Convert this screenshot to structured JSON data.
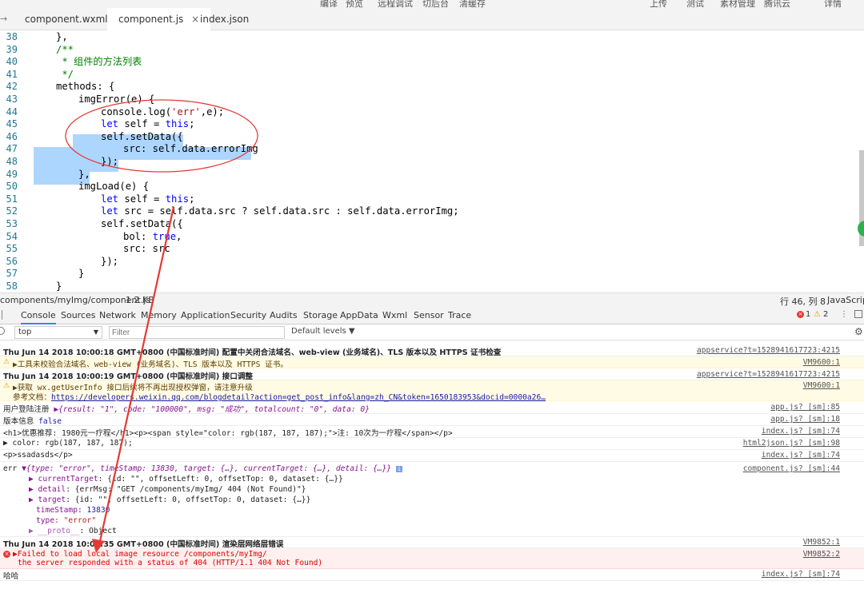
{
  "topstrip": [
    "编译",
    "预览",
    "远程调试",
    "切后台",
    "清缓存",
    "上传",
    "测试",
    "素材管理",
    "腾讯云",
    "详情"
  ],
  "tabs": [
    {
      "label": "component.wxml"
    },
    {
      "label": "component.js",
      "close": "×"
    },
    {
      "label": "index.json"
    }
  ],
  "editor": {
    "lines": [
      38,
      39,
      40,
      41,
      42,
      43,
      44,
      45,
      46,
      47,
      48,
      49,
      50,
      51,
      52,
      53,
      54,
      55,
      56,
      57,
      58
    ],
    "code": {
      "l38": "},",
      "l39": "/**",
      "l40": " * 组件的方法列表",
      "l41": " */",
      "l42": "methods: {",
      "l43": "imgError(e) {",
      "l44_a": "console.log(",
      "l44_b": "'err'",
      "l44_c": ",e);",
      "l45_a": "let",
      "l45_b": " self = ",
      "l45_c": "this",
      "l45_d": ";",
      "l46": "self.setData({",
      "l47": "src: self.data.errorImg",
      "l48": "});",
      "l49": "},",
      "l50": "imgLoad(e) {",
      "l51_a": "let",
      "l51_b": " self = ",
      "l51_c": "this",
      "l51_d": ";",
      "l52_a": "let",
      "l52_b": " src = self.data.src ? self.data.src : self.data.errorImg;",
      "l53": "self.setData({",
      "l54_a": "bol: ",
      "l54_b": "true",
      "l54_c": ",",
      "l55": "src: src",
      "l56": "});",
      "l57": "}",
      "l58": "}"
    }
  },
  "statusbar": {
    "path": "components/myImg/component.js",
    "size": "1.2 KB",
    "position": "行 46, 列 8",
    "language": "JavaScript"
  },
  "devtools_tabs": [
    "Console",
    "Sources",
    "Network",
    "Memory",
    "Application",
    "Security",
    "Audits",
    "Storage",
    "AppData",
    "Wxml",
    "Sensor",
    "Trace"
  ],
  "filter": {
    "context": "top",
    "placeholder": "Filter",
    "levels": "Default levels ▼",
    "errors": "1",
    "warnings": "2"
  },
  "console": {
    "r1_text": "Thu Jun 14 2018 10:00:18 GMT+0800 (中国标准时间) 配置中关闭合法域名、web-view (业务域名)、TLS 版本以及 HTTPS 证书检查",
    "r1_src": "appservice?t=1528941617723:4215",
    "r2_text": "▶工具未校验合法域名、web-view (业务域名)、TLS 版本以及 HTTPS 证书。",
    "r2_src": "VM9600:1",
    "r3_text": "Thu Jun 14 2018 10:00:19 GMT+0800 (中国标准时间) 接口调整",
    "r3_src": "appservice?t=1528941617723:4215",
    "r4_text1": "▶获取 wx.getUserInfo 接口后续将不再出现授权弹窗，请注意升级",
    "r4_text2_label": "参考文档：",
    "r4_text2_link": "https://developers.weixin.qq.com/blogdetail?action=get_post_info&lang=zh_CN&token=1650183953&docid=0000a26…",
    "r4_src": "VM9600:1",
    "r5_label": "用户登陆注册 ",
    "r5_obj": "▶{result: \"1\", code: \"100000\", msg: \"成功\", totalcount: \"0\", data: 0}",
    "r5_src": "app.js? [sm]:85",
    "r6_label": "版本信息 ",
    "r6_val": "false",
    "r6_src": "app.js? [sm]:18",
    "r7_text": "<h1>优惠推荐: 1980元一疗程</h1><p><span style=\"color: rgb(187, 187, 187);\">注: 10次为一疗程</span></p>",
    "r7_src": "index.js? [sm]:74",
    "r8_text": "▶ color: rgb(187, 187, 187);",
    "r8_src": "html2json.js? [sm]:98",
    "r9_text": "<p>ssadasds</p>",
    "r9_src": "index.js? [sm]:74",
    "r10_head_a": "err ",
    "r10_head_b": "▼{type: \"error\", timeStamp: 13830, target: {…}, currentTarget: {…}, detail: {…}}",
    "r10_src": "component.js? [sm]:44",
    "r10_l1_a": "▶ currentTarget",
    "r10_l1_b": ": {id: \"\", offsetLeft: 0, offsetTop: 0, dataset: {…}}",
    "r10_l2_a": "▶ detail",
    "r10_l2_b": ": {errMsg: \"GET /components/myImg/ 404 (Not Found)\"}",
    "r10_l3_a": "▶ target",
    "r10_l3_b": ": {id: \"\", offsetLeft: 0, offsetTop: 0, dataset: {…}}",
    "r10_l4_a": "timeStamp",
    "r10_l4_b": ": 13830",
    "r10_l5_a": "type",
    "r10_l5_b": ": \"error\"",
    "r10_l6_a": "▶ __proto__",
    "r10_l6_b": ": Object",
    "r11_text": "Thu Jun 14 2018 10:00:35 GMT+0800 (中国标准时间) 渲染层网络层错误",
    "r11_src": "VM9852:1",
    "r12_text1": "▶Failed to load local image resource /components/myImg/",
    "r12_text2": "the server responded with a status of 404 (HTTP/1.1 404 Not Found)",
    "r12_src": "VM9852:2",
    "r13_text": "哈哈",
    "r13_src": "index.js? [sm]:74"
  },
  "colors": {
    "selection": "#add6ff",
    "keyword": "#0000ff",
    "string": "#a31515",
    "comment": "#008000",
    "annotation": "#e53935"
  }
}
